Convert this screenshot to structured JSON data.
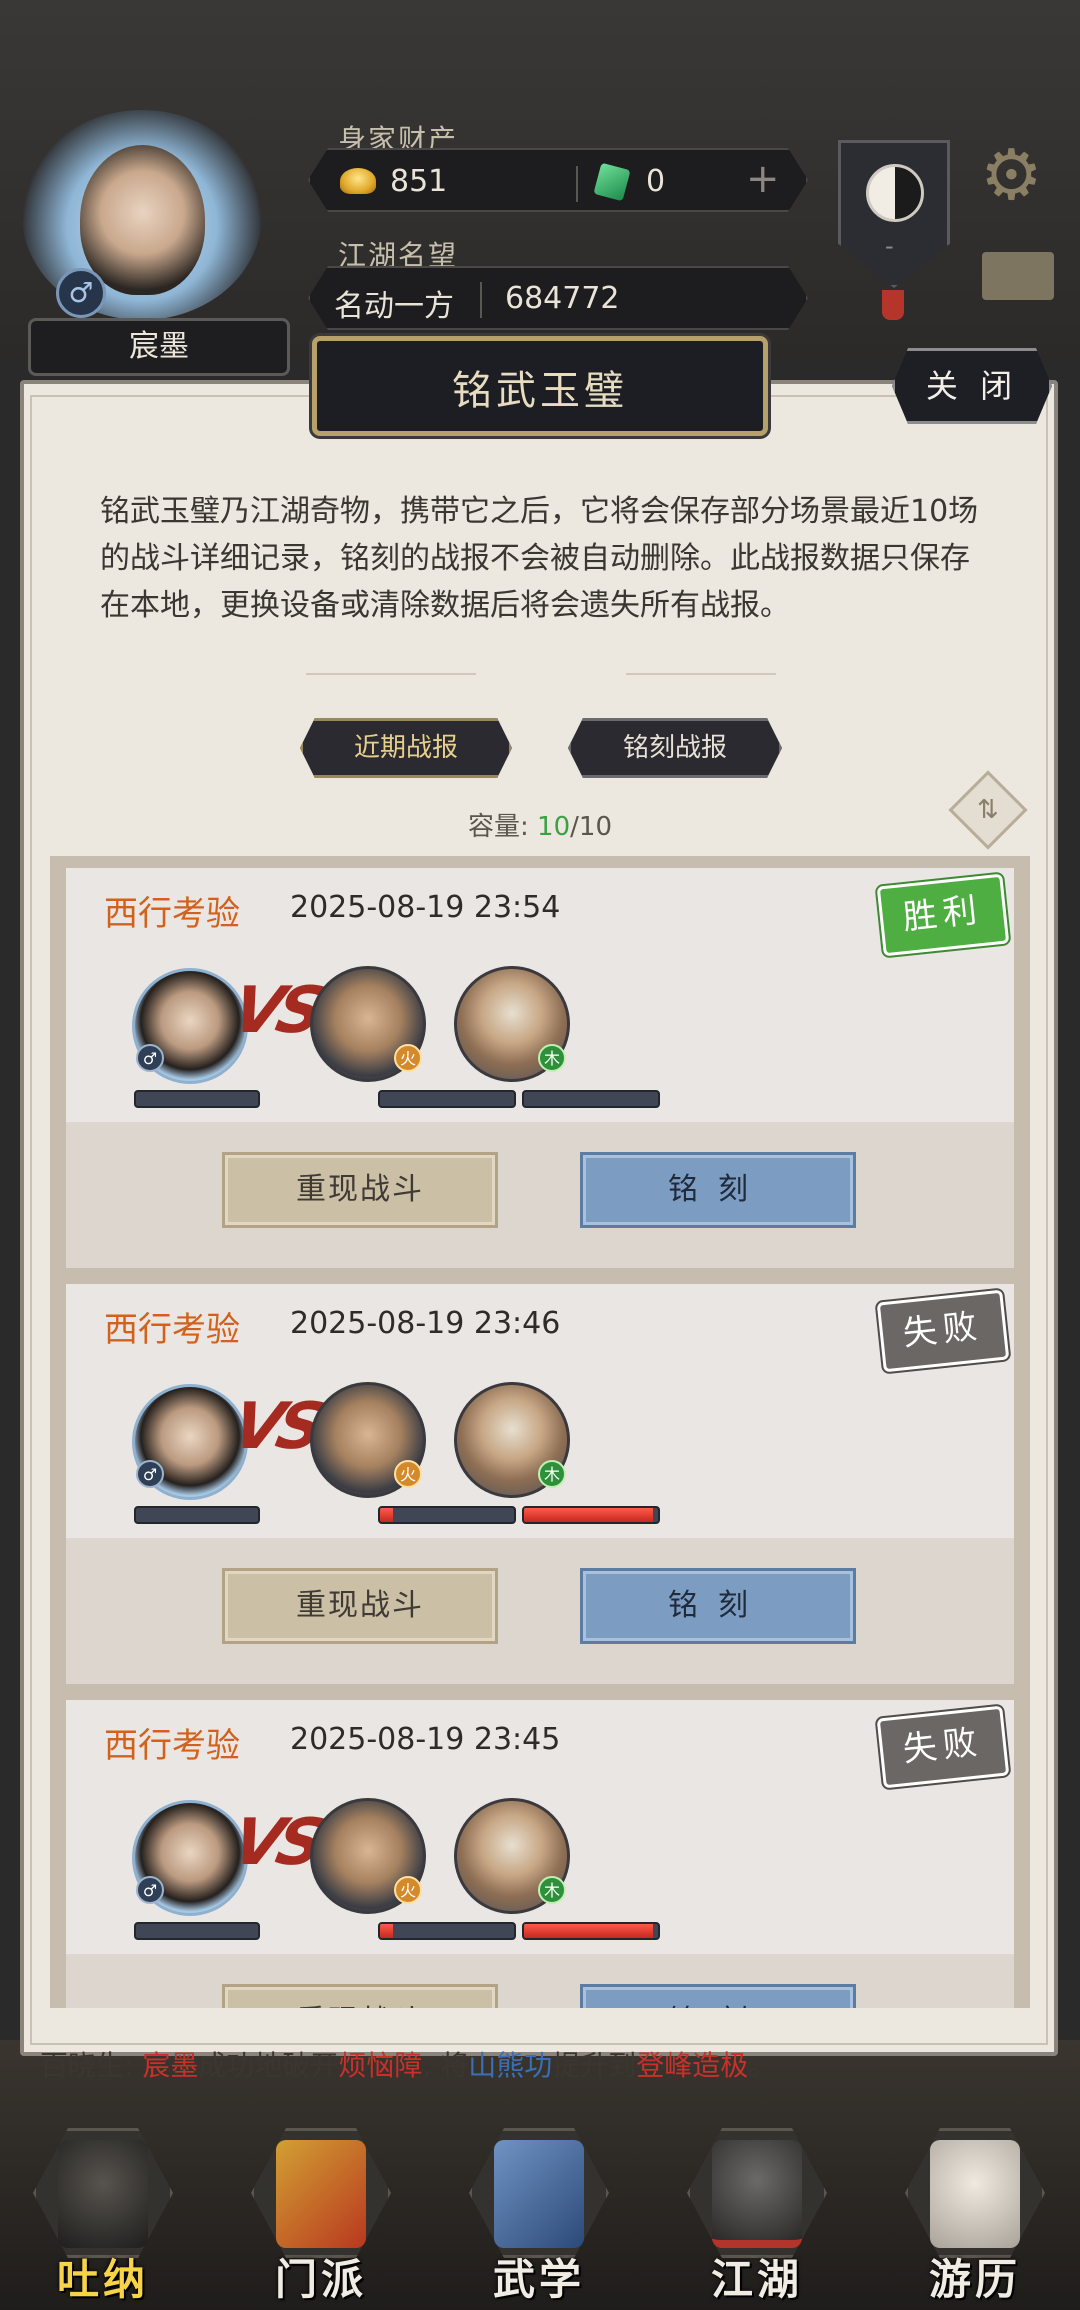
{
  "header": {
    "player_name": "宸墨",
    "gender_symbol": "♂",
    "wealth_label": "身家财产",
    "gold": "851",
    "jade": "0",
    "fame_label": "江湖名望",
    "fame_title": "名动一方",
    "fame_value": "684772",
    "taiji_dash": "-"
  },
  "panel": {
    "title": "铭武玉璧",
    "close_label": "关 闭",
    "description": "铭武玉璧乃江湖奇物，携带它之后，它将会保存部分场景最近10场的战斗详细记录，铭刻的战报不会被自动删除。此战报数据只保存在本地，更换设备或清除数据后将会遗失所有战报。",
    "tabs": [
      {
        "label": "近期战报",
        "active": true
      },
      {
        "label": "铭刻战报",
        "active": false
      }
    ],
    "capacity_label": "容量:",
    "capacity_used": "10",
    "capacity_total": "/10"
  },
  "records": [
    {
      "mode": "西行考验",
      "time": "2025-08-19 23:54",
      "result": "胜利",
      "enemy_hp": [
        0,
        0
      ],
      "replay_label": "重现战斗",
      "engrave_label": "铭刻"
    },
    {
      "mode": "西行考验",
      "time": "2025-08-19 23:46",
      "result": "失败",
      "enemy_hp": [
        0.1,
        0.96
      ],
      "replay_label": "重现战斗",
      "engrave_label": "铭刻"
    },
    {
      "mode": "西行考验",
      "time": "2025-08-19 23:45",
      "result": "失败",
      "enemy_hp": [
        0.1,
        0.96
      ],
      "replay_label": "重现战斗",
      "engrave_label": "铭刻"
    }
  ],
  "chat": {
    "sender": "百晓生:",
    "name": "宸墨",
    "text1": "成功地破开",
    "obstacle": "烦恼障",
    "text2": ", 将",
    "skill": "山熊功",
    "text3": "提升到",
    "level": "登峰造极",
    "text4": "。"
  },
  "nav": [
    {
      "label": "吐纳",
      "active": true
    },
    {
      "label": "门派",
      "active": false
    },
    {
      "label": "武学",
      "active": false
    },
    {
      "label": "江湖",
      "active": false
    },
    {
      "label": "游历",
      "active": false
    }
  ],
  "colors": {
    "accent_orange": "#d4611b",
    "win_green": "#4fae42",
    "lose_gray": "#6a6764",
    "engrave_blue": "#7c9cc1"
  }
}
